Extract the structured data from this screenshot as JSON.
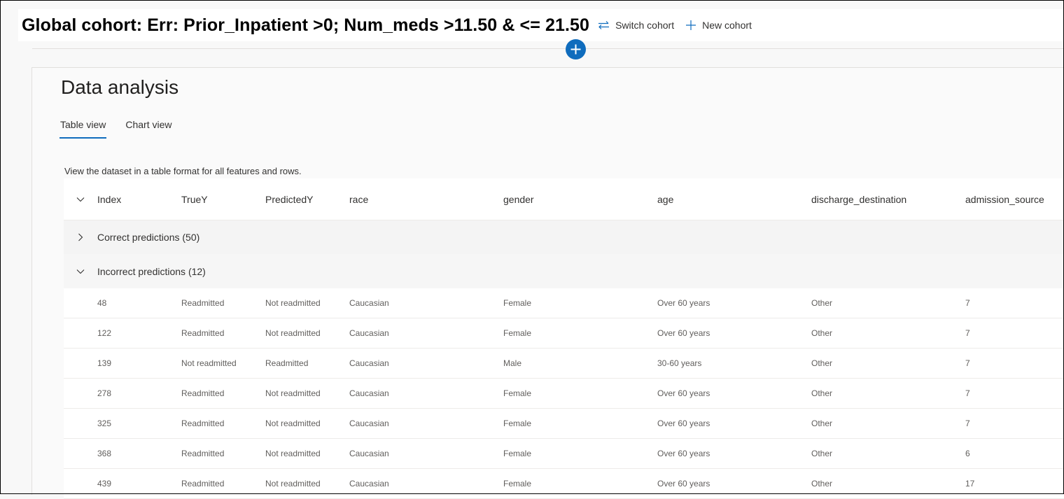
{
  "header": {
    "cohort_title": "Global cohort: Err: Prior_Inpatient >0; Num_meds >11.50 & <= 21.50",
    "switch_cohort_label": "Switch cohort",
    "new_cohort_label": "New cohort"
  },
  "panel": {
    "title": "Data analysis",
    "tabs": [
      {
        "label": "Table view",
        "active": true
      },
      {
        "label": "Chart view",
        "active": false
      }
    ],
    "description": "View the dataset in a table format for all features and rows."
  },
  "table": {
    "columns": [
      "Index",
      "TrueY",
      "PredictedY",
      "race",
      "gender",
      "age",
      "discharge_destination",
      "admission_source"
    ],
    "groups": [
      {
        "label": "Correct predictions (50)",
        "expanded": false
      },
      {
        "label": "Incorrect predictions (12)",
        "expanded": true
      }
    ],
    "rows": [
      [
        "48",
        "Readmitted",
        "Not readmitted",
        "Caucasian",
        "Female",
        "Over 60 years",
        "Other",
        "7"
      ],
      [
        "122",
        "Readmitted",
        "Not readmitted",
        "Caucasian",
        "Female",
        "Over 60 years",
        "Other",
        "7"
      ],
      [
        "139",
        "Not readmitted",
        "Readmitted",
        "Caucasian",
        "Male",
        "30-60 years",
        "Other",
        "7"
      ],
      [
        "278",
        "Readmitted",
        "Not readmitted",
        "Caucasian",
        "Female",
        "Over 60 years",
        "Other",
        "7"
      ],
      [
        "325",
        "Readmitted",
        "Not readmitted",
        "Caucasian",
        "Female",
        "Over 60 years",
        "Other",
        "7"
      ],
      [
        "368",
        "Readmitted",
        "Not readmitted",
        "Caucasian",
        "Female",
        "Over 60 years",
        "Other",
        "6"
      ],
      [
        "439",
        "Readmitted",
        "Not readmitted",
        "Caucasian",
        "Female",
        "Over 60 years",
        "Other",
        "17"
      ]
    ]
  },
  "colors": {
    "accent": "#0f6cbd"
  }
}
